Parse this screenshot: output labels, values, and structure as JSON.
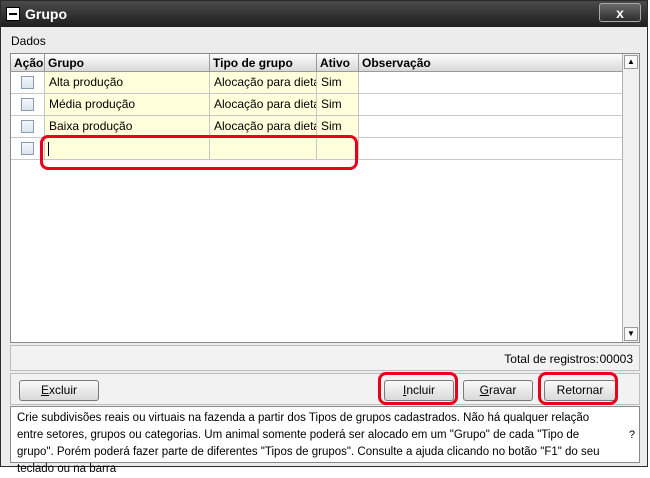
{
  "window": {
    "title": "Grupo",
    "close_label": "x"
  },
  "section_label": "Dados",
  "table": {
    "headers": {
      "acao": "Ação",
      "grupo": "Grupo",
      "tipo": "Tipo de grupo",
      "ativo": "Ativo",
      "obs": "Observação"
    },
    "rows": [
      {
        "grupo": "Alta produção",
        "tipo": "Alocação para dietas",
        "ativo": "Sim",
        "obs": ""
      },
      {
        "grupo": "Média produção",
        "tipo": "Alocação para dietas",
        "ativo": "Sim",
        "obs": ""
      },
      {
        "grupo": "Baixa produção",
        "tipo": "Alocação para dietas",
        "ativo": "Sim",
        "obs": ""
      },
      {
        "grupo": "",
        "tipo": "",
        "ativo": "",
        "obs": ""
      }
    ]
  },
  "totals": {
    "label": "Total de registros:",
    "value": "00003"
  },
  "buttons": {
    "excluir": {
      "hot": "E",
      "rest": "xcluir"
    },
    "incluir": {
      "hot": "I",
      "rest": "ncluir"
    },
    "gravar": {
      "hot": "G",
      "rest": "ravar"
    },
    "retornar": {
      "hot": "",
      "rest": "Retornar"
    }
  },
  "help": {
    "text": "Crie subdivisões reais ou virtuais na fazenda a partir dos Tipos de grupos cadastrados. Não há qualquer relação entre setores, grupos ou categorias. Um animal somente poderá ser alocado em um \"Grupo\" de cada \"Tipo de grupo\". Porém poderá fazer parte de diferentes \"Tipos de grupos\". Consulte a ajuda clicando no botão \"F1\" do seu teclado ou na barra",
    "question": "?"
  },
  "colors": {
    "highlight": "#e8001c",
    "editable_cell": "#ffffdc",
    "titlebar": "#1e1e1e"
  }
}
